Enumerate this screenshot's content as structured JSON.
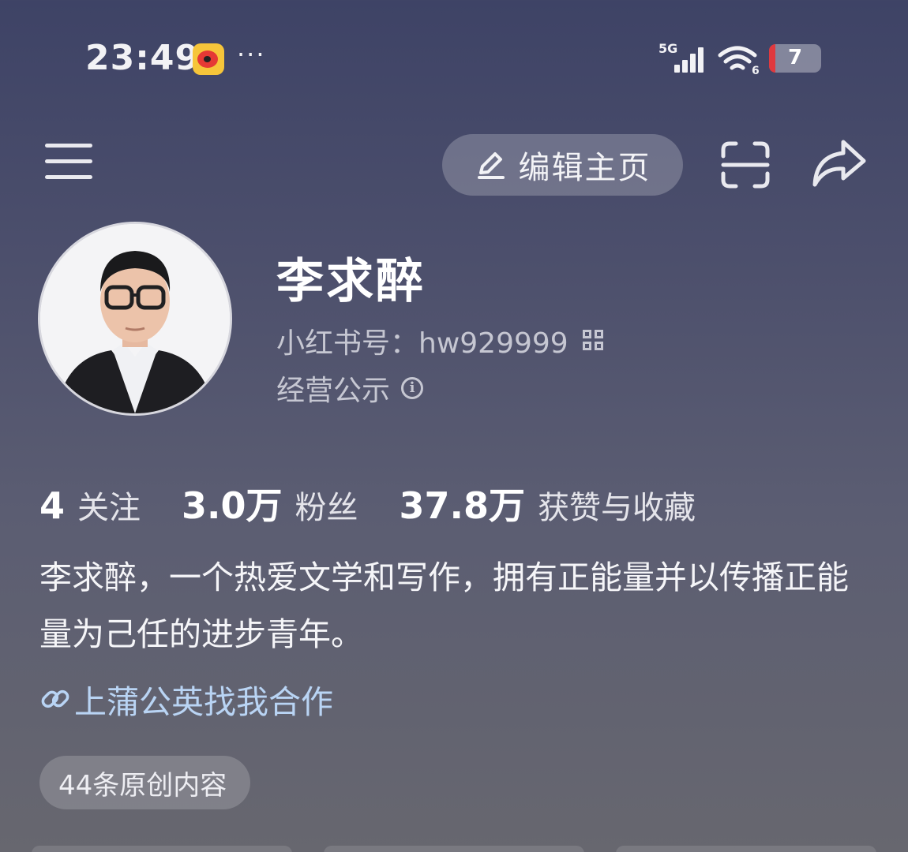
{
  "status_bar": {
    "time": "23:49",
    "more_dots": "···",
    "network": "5G",
    "wifi_badge": "6",
    "battery_level": "7"
  },
  "nav": {
    "edit_label": "编辑主页"
  },
  "profile": {
    "name": "李求醉",
    "red_id": "小红书号：hw929999",
    "business_info": "经营公示"
  },
  "stats": [
    {
      "value": "4",
      "label": "关注"
    },
    {
      "value": "3.0万",
      "label": "粉丝"
    },
    {
      "value": "37.8万",
      "label": "获赞与收藏"
    }
  ],
  "bio": "李求醉，一个热爱文学和写作，拥有正能量并以传播正能量为己任的进步青年。",
  "collab_link": "上蒲公英找我合作",
  "original_badge": "44条原创内容",
  "colors": {
    "battery_low": "#e0393e",
    "link": "#b9d4f4",
    "weibo_yellow": "#f6c53a"
  }
}
